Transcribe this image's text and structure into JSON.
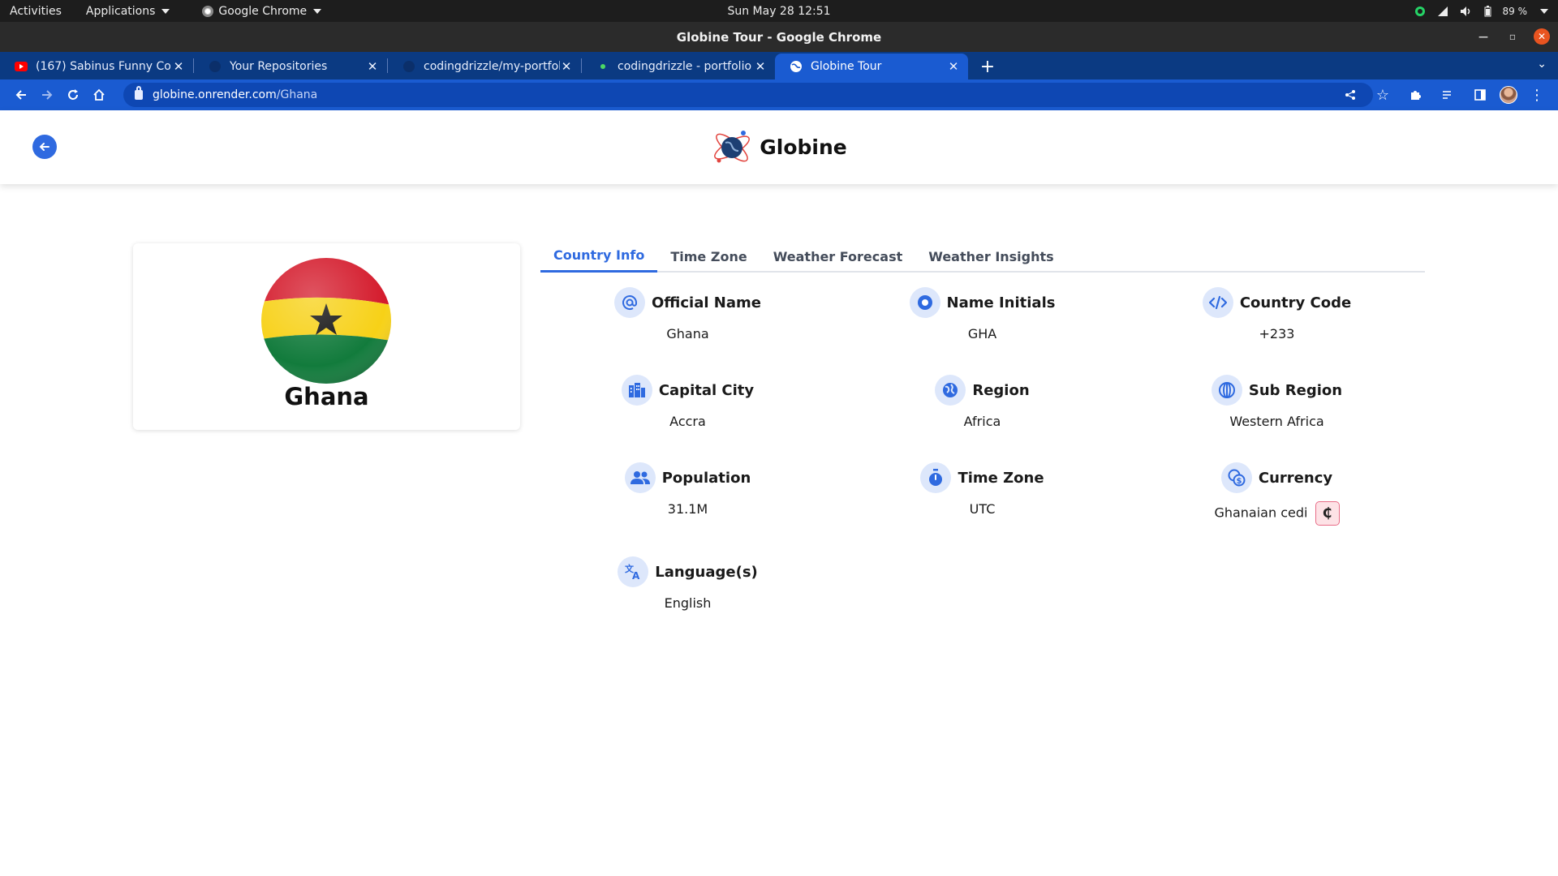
{
  "system_bar": {
    "activities": "Activities",
    "applications": "Applications",
    "app_menu": "Google Chrome",
    "clock": "Sun May 28  12:51",
    "battery": "89 %"
  },
  "window": {
    "title": "Globine Tour - Google Chrome"
  },
  "browser": {
    "tabs": [
      {
        "title": "(167) Sabinus Funny Come",
        "icon": "youtube-icon"
      },
      {
        "title": "Your Repositories",
        "icon": "github-icon"
      },
      {
        "title": "codingdrizzle/my-portfoli",
        "icon": "github-icon"
      },
      {
        "title": "codingdrizzle - portfolio",
        "icon": "render-icon"
      },
      {
        "title": "Globine Tour",
        "icon": "globe-icon"
      }
    ],
    "url_host": "globine.onrender.com",
    "url_path": "/Ghana"
  },
  "site": {
    "brand": "Globine",
    "country": "Ghana",
    "tabs": [
      "Country Info",
      "Time Zone",
      "Weather Forecast",
      "Weather Insights"
    ],
    "active_tab": "Country Info",
    "info": [
      {
        "label": "Official Name",
        "value": "Ghana",
        "icon": "at-icon"
      },
      {
        "label": "Name Initials",
        "value": "GHA",
        "icon": "target-icon"
      },
      {
        "label": "Country Code",
        "value": "+233",
        "icon": "code-icon"
      },
      {
        "label": "Capital City",
        "value": "Accra",
        "icon": "city-icon"
      },
      {
        "label": "Region",
        "value": "Africa",
        "icon": "globe-icon"
      },
      {
        "label": "Sub Region",
        "value": "Western Africa",
        "icon": "sphere-icon"
      },
      {
        "label": "Population",
        "value": "31.1M",
        "icon": "people-icon"
      },
      {
        "label": "Time Zone",
        "value": "UTC",
        "icon": "timer-icon"
      },
      {
        "label": "Currency",
        "value": "Ghanaian cedi",
        "symbol": "₵",
        "icon": "currency-exchange-icon"
      },
      {
        "label": "Language(s)",
        "value": "English",
        "icon": "translate-icon"
      }
    ]
  },
  "colors": {
    "accent": "#2f6ae0",
    "tab_strip": "#0b3a82",
    "toolbar": "#1a5bd1",
    "icon_bg": "#dde7fb",
    "cedi_bg": "#fde2e6"
  }
}
